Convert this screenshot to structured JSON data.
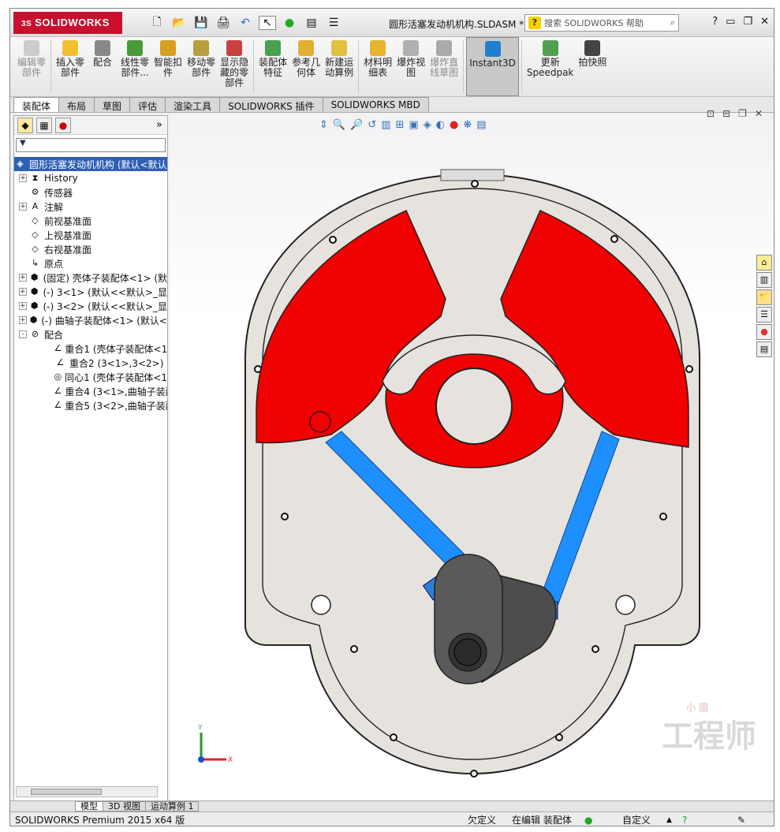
{
  "app": {
    "logo_ds": "3S",
    "logo_text": "SOLIDWORKS",
    "doc_title": "圆形活塞发动机机构.SLDASM *",
    "help_placeholder": "搜索 SOLIDWORKS 帮助",
    "help_q": "?",
    "help_icon": "?"
  },
  "ribbon": {
    "buttons": [
      {
        "l1": "编辑零",
        "l2": "部件",
        "disabled": true
      },
      {
        "l1": "插入零",
        "l2": "部件"
      },
      {
        "l1": "配合",
        "l2": ""
      },
      {
        "l1": "线性零",
        "l2": "部件..."
      },
      {
        "l1": "智能扣",
        "l2": "件"
      },
      {
        "l1": "移动零",
        "l2": "部件"
      },
      {
        "l1": "显示隐",
        "l2": "藏的零",
        "l3": "部件"
      },
      {
        "l1": "装配体",
        "l2": "特征"
      },
      {
        "l1": "参考几",
        "l2": "何体"
      },
      {
        "l1": "新建运",
        "l2": "动算例"
      },
      {
        "l1": "材料明",
        "l2": "细表"
      },
      {
        "l1": "爆炸视",
        "l2": "图"
      },
      {
        "l1": "爆炸直",
        "l2": "线草图",
        "disabled": true
      },
      {
        "l1": "Instant3D",
        "l2": "",
        "selected": true
      },
      {
        "l1": "更新",
        "l2": "Speedpak"
      },
      {
        "l1": "拍快照",
        "l2": ""
      }
    ]
  },
  "tabs": [
    "装配体",
    "布局",
    "草图",
    "评估",
    "渲染工具",
    "SOLIDWORKS 插件",
    "SOLIDWORKS MBD"
  ],
  "tree": {
    "root": "圆形活塞发动机机构  (默认<默认",
    "items": [
      {
        "label": "History",
        "exp": "+"
      },
      {
        "label": "传感器",
        "exp": ""
      },
      {
        "label": "注解",
        "exp": "+"
      },
      {
        "label": "前视基准面",
        "exp": ""
      },
      {
        "label": "上视基准面",
        "exp": ""
      },
      {
        "label": "右视基准面",
        "exp": ""
      },
      {
        "label": "原点",
        "exp": ""
      },
      {
        "label": "(固定) 壳体子装配体<1> (默",
        "exp": "+"
      },
      {
        "label": "(-) 3<1> (默认<<默认>_显",
        "exp": "+"
      },
      {
        "label": "(-) 3<2> (默认<<默认>_显",
        "exp": "+"
      },
      {
        "label": "(-) 曲轴子装配体<1> (默认<",
        "exp": "+"
      },
      {
        "label": "配合",
        "exp": "-"
      },
      {
        "label": "重合1 (壳体子装配体<1>",
        "exp": "",
        "indent": true
      },
      {
        "label": "重合2 (3<1>,3<2>)",
        "exp": "",
        "indent": true
      },
      {
        "label": "同心1 (壳体子装配体<1>",
        "exp": "",
        "indent": true
      },
      {
        "label": "重合4 (3<1>,曲轴子装配",
        "exp": "",
        "indent": true
      },
      {
        "label": "重合5 (3<2>,曲轴子装配",
        "exp": "",
        "indent": true
      }
    ]
  },
  "bottom_tabs": [
    "模型",
    "3D 视图",
    "运动算例 1"
  ],
  "status": {
    "product": "SOLIDWORKS Premium 2015 x64 版",
    "s1": "欠定义",
    "s2": "在编辑 装配体",
    "s3": "自定义"
  },
  "watermark": {
    "line1": "工程师",
    "line2": "小 國"
  },
  "colors": {
    "red": "#f00000",
    "blue": "#1e90ff",
    "housing": "#e6e2de",
    "crank": "#555555"
  }
}
